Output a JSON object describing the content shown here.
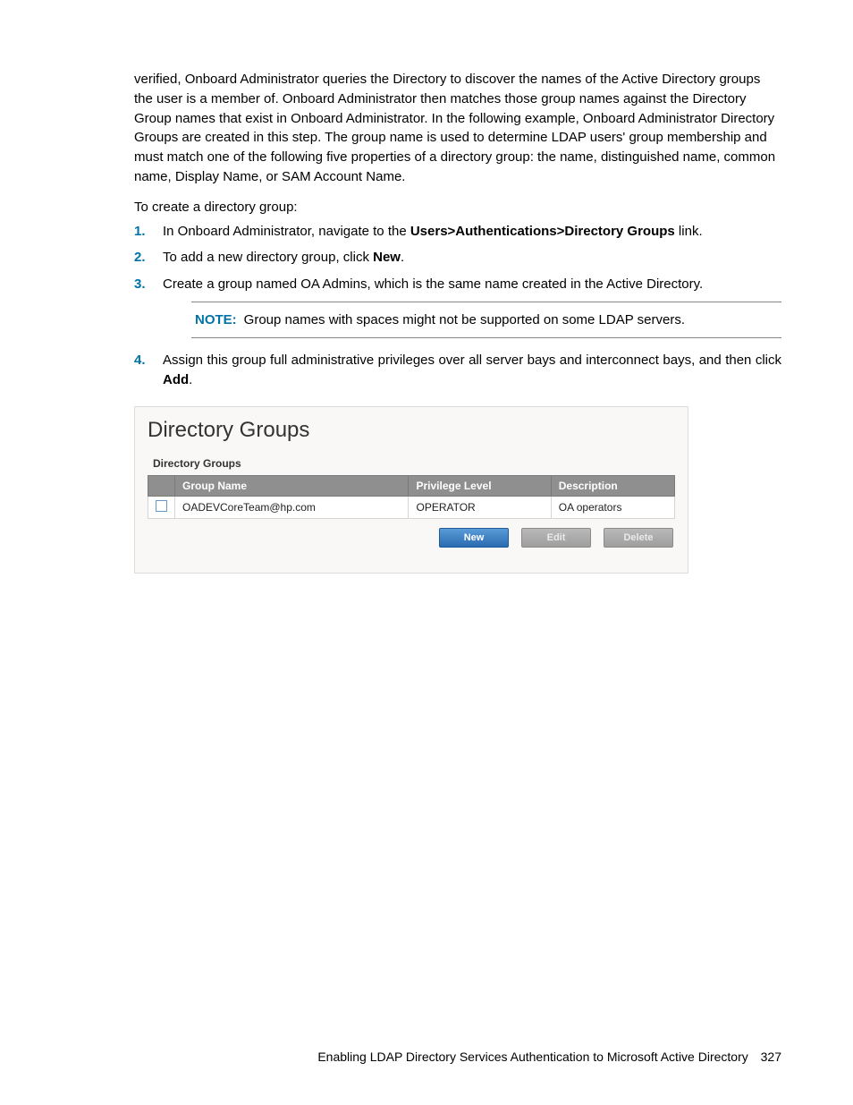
{
  "intro_paragraph": "verified, Onboard Administrator queries the Directory to discover the names of the Active Directory groups the user is a member of. Onboard Administrator then matches those group names against the Directory Group names that exist in Onboard Administrator. In the following example, Onboard Administrator Directory Groups are created in this step. The group name is used to determine LDAP users' group membership and must match one of the following five properties of a directory group: the name, distinguished name, common name, Display Name, or SAM Account Name.",
  "lead": "To create a directory group:",
  "steps": {
    "s1": {
      "num": "1.",
      "pre": "In Onboard Administrator, navigate to the ",
      "bold": "Users>Authentications>Directory Groups",
      "post": " link."
    },
    "s2": {
      "num": "2.",
      "pre": "To add a new directory group, click ",
      "bold": "New",
      "post": "."
    },
    "s3": {
      "num": "3.",
      "text": "Create a group named OA Admins, which is the same name created in the Active Directory."
    },
    "note": {
      "label": "NOTE:",
      "text": "Group names with spaces might not be supported on some LDAP servers."
    },
    "s4": {
      "num": "4.",
      "pre": "Assign this group full administrative privileges over all server bays and interconnect bays, and then click ",
      "bold": "Add",
      "post": "."
    }
  },
  "panel": {
    "title": "Directory Groups",
    "subtitle": "Directory Groups",
    "headers": {
      "group_name": "Group Name",
      "privilege": "Privilege Level",
      "description": "Description"
    },
    "row": {
      "group_name": "OADEVCoreTeam@hp.com",
      "privilege": "OPERATOR",
      "description": "OA operators"
    },
    "buttons": {
      "new": "New",
      "edit": "Edit",
      "delete": "Delete"
    }
  },
  "footer": {
    "title": "Enabling LDAP Directory Services Authentication to Microsoft Active Directory",
    "page": "327"
  }
}
